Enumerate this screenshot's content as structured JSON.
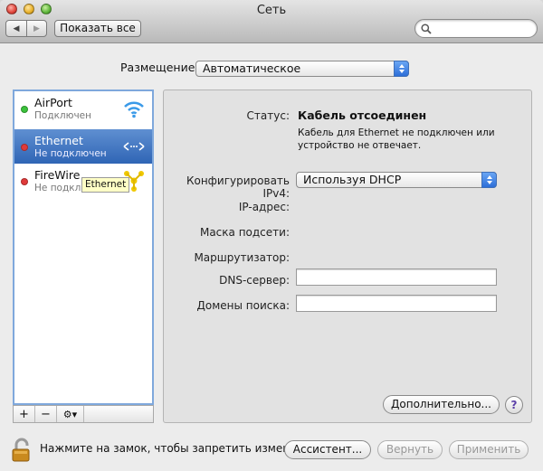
{
  "window": {
    "title": "Сеть"
  },
  "toolbar": {
    "back_icon": "chevron-left-icon",
    "forward_icon": "chevron-right-icon",
    "show_all_label": "Показать все",
    "search_placeholder": "",
    "search_icon": "search-icon"
  },
  "location": {
    "label": "Размещение:",
    "value": "Автоматическое"
  },
  "services": [
    {
      "name": "AirPort",
      "status": "Подключен",
      "dot_color": "#3bc23b",
      "icon": "wifi-icon"
    },
    {
      "name": "Ethernet",
      "status": "Не подключен",
      "dot_color": "#e03a3a",
      "icon": "ethernet-icon",
      "selected": true
    },
    {
      "name": "FireWire",
      "status": "Не подкл",
      "dot_color": "#e03a3a",
      "icon": "firewire-icon"
    }
  ],
  "tooltip": {
    "text": "Ethernet"
  },
  "sidebar_controls": {
    "add": "+",
    "remove": "−",
    "gear": "⚙▾"
  },
  "details": {
    "status_label": "Статус:",
    "status_value": "Кабель отсоединен",
    "status_description": "Кабель для Ethernet не подключен или устройство не отвечает.",
    "ipv4_label": "Конфигурировать IPv4:",
    "ipv4_value": "Используя DHCP",
    "ip_label": "IP-адрес:",
    "mask_label": "Маска подсети:",
    "router_label": "Маршрутизатор:",
    "dns_label": "DNS-сервер:",
    "dns_value": "",
    "search_domains_label": "Домены поиска:",
    "search_domains_value": "",
    "advanced_button": "Дополнительно...",
    "help_button": "?"
  },
  "footer": {
    "lock_text": "Нажмите на замок, чтобы запретить изменения.",
    "assistant_button": "Ассистент...",
    "revert_button": "Вернуть",
    "apply_button": "Применить"
  },
  "colors": {
    "selection": "#2f65b5",
    "accent": "#3f7ee0"
  }
}
